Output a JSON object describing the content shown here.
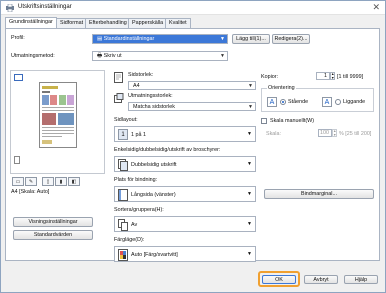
{
  "window": {
    "title": "Utskriftsinställningar",
    "close_glyph": "✕"
  },
  "tabs": [
    "Grundinställningar",
    "Sidformat",
    "Efterbehandling",
    "Papperskälla",
    "Kvalitet"
  ],
  "profile": {
    "label": "Profil:",
    "value": "Standardinställningar",
    "add_button": "Lägg till(1)...",
    "edit_button": "Redigera(2)..."
  },
  "output": {
    "label": "Utmatningsmetod:",
    "value": "Skriv ut"
  },
  "preview": {
    "caption": "A4 [Skala: Auto]",
    "page_layout_btn": "Visningsinställningar",
    "default_btn": "Standardvärden"
  },
  "page_size": {
    "label": "Sidstorlek:",
    "value": "A4"
  },
  "output_size": {
    "label": "Utmatningsstorlek:",
    "value": "Matcha sidstorlek"
  },
  "copies": {
    "label": "Kopior:",
    "value": "1",
    "range": "[1 till 9999]"
  },
  "orientation": {
    "label": "Orientering",
    "portrait": "Stående",
    "landscape": "Liggande",
    "portrait_letter": "A",
    "landscape_letter": "A"
  },
  "page_layout": {
    "label": "Sidlayout:",
    "value": "1 på 1",
    "num": "1"
  },
  "manual_scale": {
    "label": "Skala manuellt(W)",
    "scale_label": "Skala:",
    "value": "100",
    "range": "% [25 till 200]"
  },
  "duplex": {
    "label": "Enkelsidig/dubbelsidig/utskrift av broschyrer:",
    "value": "Dubbelsidig utskrift"
  },
  "binding": {
    "label": "Plats för bindning:",
    "value": "Långsida (vänster)",
    "margin_button": "Bindmarginal..."
  },
  "collate": {
    "label": "Sortera/gruppera(H):",
    "value": "Av"
  },
  "color_mode": {
    "label": "Färgläge(D):",
    "value": "Auto [Färg/svartvitt]"
  },
  "buttons": {
    "ok": "OK",
    "cancel": "Avbryt",
    "help": "Hjälp"
  },
  "colors": {
    "accent": "#1b5fc6",
    "selection": "#3c78d8",
    "ok_highlight": "#f0a030"
  }
}
